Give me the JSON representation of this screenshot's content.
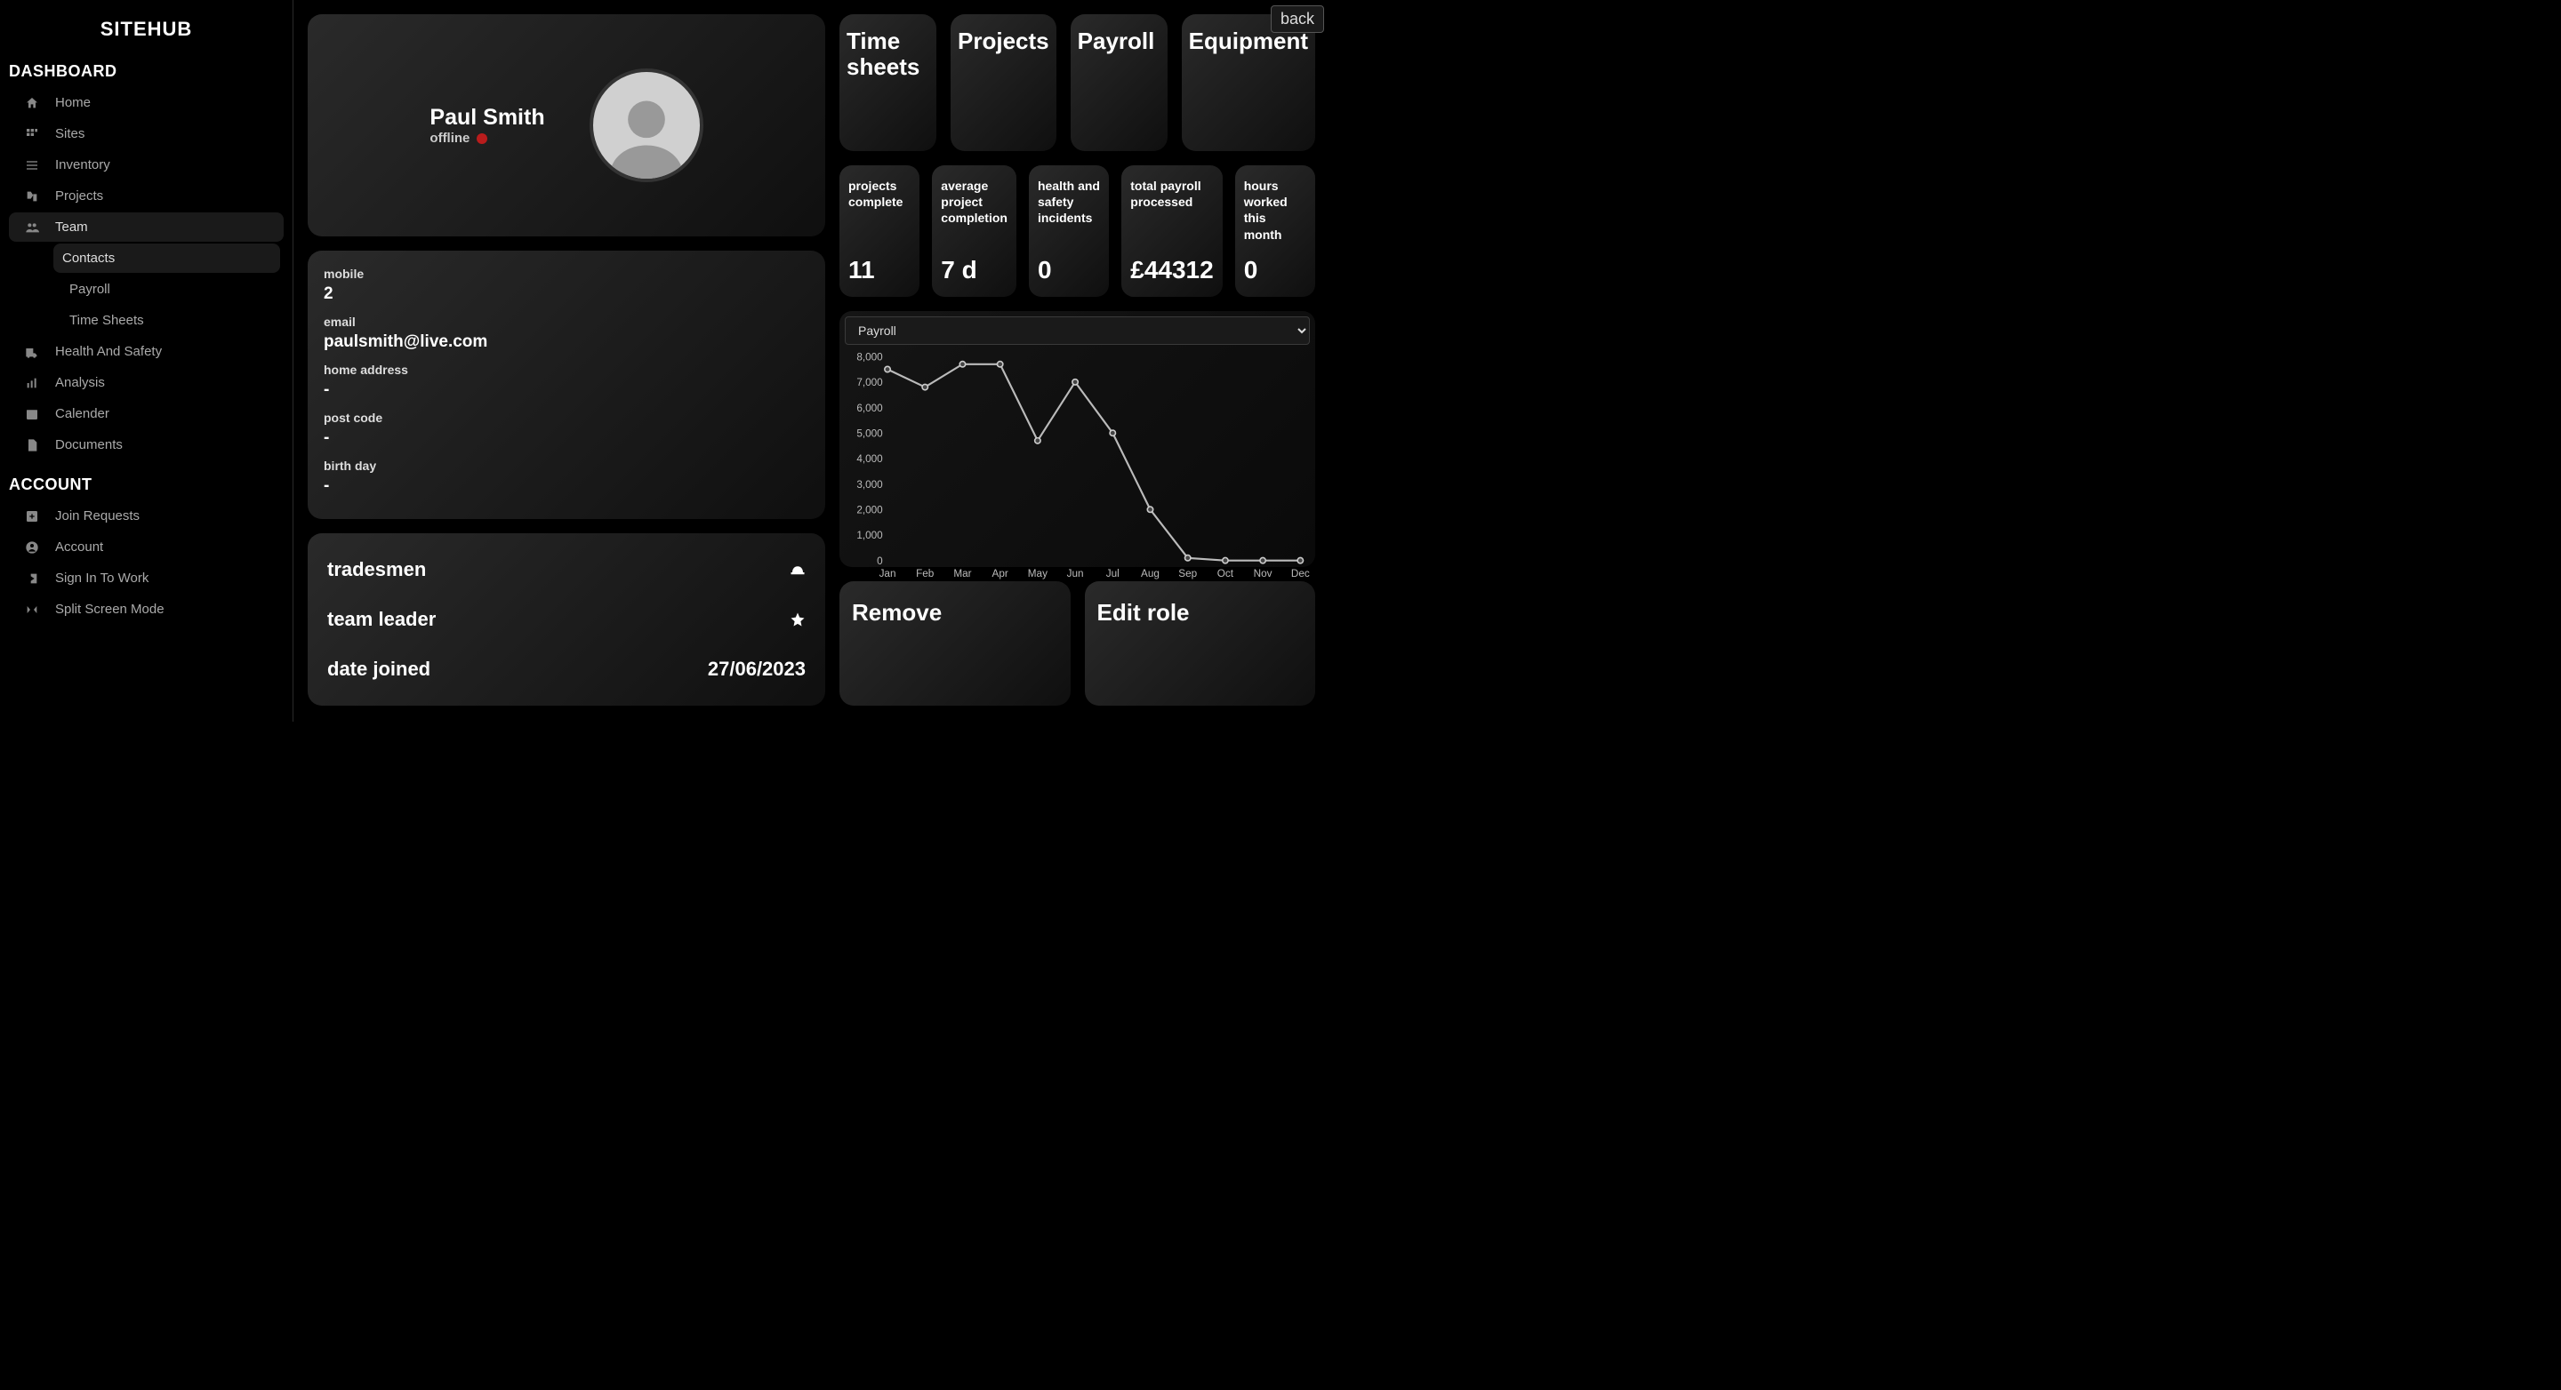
{
  "brand": "SITEHUB",
  "back_label": "back",
  "sidebar": {
    "sections": {
      "dashboard": "DASHBOARD",
      "account": "ACCOUNT"
    },
    "items": {
      "home": "Home",
      "sites": "Sites",
      "inventory": "Inventory",
      "projects": "Projects",
      "team": "Team",
      "contacts": "Contacts",
      "payroll": "Payroll",
      "timesheets": "Time Sheets",
      "health": "Health And Safety",
      "analysis": "Analysis",
      "calendar": "Calender",
      "documents": "Documents",
      "join": "Join Requests",
      "account_item": "Account",
      "signin": "Sign In To Work",
      "split": "Split Screen Mode"
    }
  },
  "profile": {
    "name": "Paul Smith",
    "status": "offline"
  },
  "details": {
    "mobile_label": "mobile",
    "mobile_value": "2",
    "email_label": "email",
    "email_value": "paulsmith@live.com",
    "address_label": "home address",
    "address_value": "-",
    "postcode_label": "post code",
    "postcode_value": "-",
    "birthday_label": "birth day",
    "birthday_value": "-"
  },
  "roles": {
    "tradesmen": "tradesmen",
    "teamleader": "team leader",
    "datejoined_label": "date joined",
    "datejoined_value": "27/06/2023"
  },
  "tabs": {
    "timesheets": "Time sheets",
    "projects": "Projects",
    "payroll": "Payroll",
    "equipment": "Equipment"
  },
  "stats": {
    "projects_complete": {
      "label": "projects complete",
      "value": "11"
    },
    "avg_completion": {
      "label": "average project completion",
      "value": "7 d"
    },
    "incidents": {
      "label": "health and safety incidents",
      "value": "0"
    },
    "payroll_total": {
      "label": "total payroll processed",
      "value": "£44312"
    },
    "hours": {
      "label": "hours worked this month",
      "value": "0"
    }
  },
  "chart": {
    "selected": "Payroll"
  },
  "chart_data": {
    "type": "line",
    "title": "Payroll",
    "xlabel": "",
    "ylabel": "",
    "ylim": [
      0,
      8000
    ],
    "categories": [
      "Jan",
      "Feb",
      "Mar",
      "Apr",
      "May",
      "Jun",
      "Jul",
      "Aug",
      "Sep",
      "Oct",
      "Nov",
      "Dec"
    ],
    "values": [
      7500,
      6800,
      7700,
      7700,
      4700,
      7000,
      5000,
      2000,
      100,
      0,
      0,
      0
    ],
    "y_ticks": [
      0,
      1000,
      2000,
      3000,
      4000,
      5000,
      6000,
      7000,
      8000
    ]
  },
  "actions": {
    "remove": "Remove",
    "edit": "Edit role"
  }
}
